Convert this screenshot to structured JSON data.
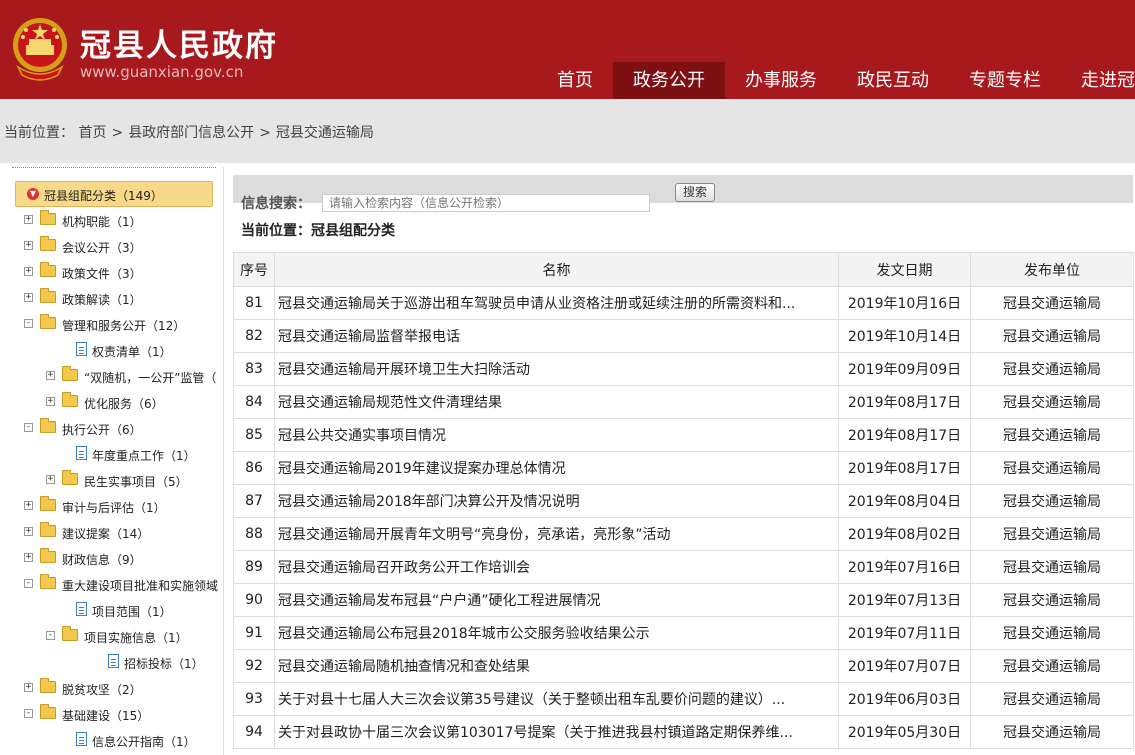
{
  "header": {
    "title": "冠县人民政府",
    "url": "www.guanxian.gov.cn",
    "nav": [
      {
        "label": "首页",
        "active": false
      },
      {
        "label": "政务公开",
        "active": true
      },
      {
        "label": "办事服务",
        "active": false
      },
      {
        "label": "政民互动",
        "active": false
      },
      {
        "label": "专题专栏",
        "active": false
      },
      {
        "label": "走进冠",
        "active": false
      }
    ]
  },
  "breadcrumb": {
    "prefix": "当前位置：",
    "items": [
      "首页",
      "县政府部门信息公开",
      "冠县交通运输局"
    ],
    "sep": ">"
  },
  "tree": {
    "root": "冠县组配分类（149）",
    "nodes": [
      {
        "label": "机构职能（1）",
        "level": 1,
        "type": "folder",
        "exp": "+"
      },
      {
        "label": "会议公开（3）",
        "level": 1,
        "type": "folder",
        "exp": "+"
      },
      {
        "label": "政策文件（3）",
        "level": 1,
        "type": "folder",
        "exp": "+"
      },
      {
        "label": "政策解读（1）",
        "level": 1,
        "type": "folder",
        "exp": "+"
      },
      {
        "label": "管理和服务公开（12）",
        "level": 1,
        "type": "folder",
        "exp": "-"
      },
      {
        "label": "权责清单（1）",
        "level": 2,
        "type": "doc",
        "exp": ""
      },
      {
        "label": "“双随机，一公开”监管（",
        "level": 2,
        "type": "folder",
        "exp": "+"
      },
      {
        "label": "优化服务（6）",
        "level": 2,
        "type": "folder",
        "exp": "+"
      },
      {
        "label": "执行公开（6）",
        "level": 1,
        "type": "folder",
        "exp": "-"
      },
      {
        "label": "年度重点工作（1）",
        "level": 2,
        "type": "doc",
        "exp": ""
      },
      {
        "label": "民生实事项目（5）",
        "level": 2,
        "type": "folder",
        "exp": "+"
      },
      {
        "label": "审计与后评估（1）",
        "level": 1,
        "type": "folder",
        "exp": "+"
      },
      {
        "label": "建议提案（14）",
        "level": 1,
        "type": "folder",
        "exp": "+"
      },
      {
        "label": "财政信息（9）",
        "level": 1,
        "type": "folder",
        "exp": "+"
      },
      {
        "label": "重大建设项目批准和实施领域",
        "level": 1,
        "type": "folder",
        "exp": "-"
      },
      {
        "label": "项目范围（1）",
        "level": 2,
        "type": "doc",
        "exp": ""
      },
      {
        "label": "项目实施信息（1）",
        "level": 2,
        "type": "folder",
        "exp": "-"
      },
      {
        "label": "招标投标（1）",
        "level": 3,
        "type": "doc",
        "exp": ""
      },
      {
        "label": "脱贫攻坚（2）",
        "level": 1,
        "type": "folder",
        "exp": "+"
      },
      {
        "label": "基础建设（15）",
        "level": 1,
        "type": "folder",
        "exp": "-"
      },
      {
        "label": "信息公开指南（1）",
        "level": 2,
        "type": "doc",
        "exp": ""
      }
    ]
  },
  "search": {
    "label": "信息搜索：",
    "placeholder": "请输入检索内容（信息公开检索）",
    "button": "搜索"
  },
  "location": "当前位置：冠县组配分类",
  "table": {
    "headers": [
      "序号",
      "名称",
      "发文日期",
      "发布单位"
    ],
    "rows": [
      [
        "81",
        "冠县交通运输局关于巡游出租车驾驶员申请从业资格注册或延续注册的所需资料和...",
        "2019年10月16日",
        "冠县交通运输局"
      ],
      [
        "82",
        "冠县交通运输局监督举报电话",
        "2019年10月14日",
        "冠县交通运输局"
      ],
      [
        "83",
        "冠县交通运输局开展环境卫生大扫除活动",
        "2019年09月09日",
        "冠县交通运输局"
      ],
      [
        "84",
        "冠县交通运输局规范性文件清理结果",
        "2019年08月17日",
        "冠县交通运输局"
      ],
      [
        "85",
        "冠县公共交通实事项目情况",
        "2019年08月17日",
        "冠县交通运输局"
      ],
      [
        "86",
        "冠县交通运输局2019年建议提案办理总体情况",
        "2019年08月17日",
        "冠县交通运输局"
      ],
      [
        "87",
        "冠县交通运输局2018年部门决算公开及情况说明",
        "2019年08月04日",
        "冠县交通运输局"
      ],
      [
        "88",
        "冠县交通运输局开展青年文明号“亮身份，亮承诺，亮形象”活动",
        "2019年08月02日",
        "冠县交通运输局"
      ],
      [
        "89",
        "冠县交通运输局召开政务公开工作培训会",
        "2019年07月16日",
        "冠县交通运输局"
      ],
      [
        "90",
        "冠县交通运输局发布冠县“户户通”硬化工程进展情况",
        "2019年07月13日",
        "冠县交通运输局"
      ],
      [
        "91",
        "冠县交通运输局公布冠县2018年城市公交服务验收结果公示",
        "2019年07月11日",
        "冠县交通运输局"
      ],
      [
        "92",
        "冠县交通运输局随机抽查情况和查处结果",
        "2019年07月07日",
        "冠县交通运输局"
      ],
      [
        "93",
        "关于对县十七届人大三次会议第35号建议（关于整顿出租车乱要价问题的建议）...",
        "2019年06月03日",
        "冠县交通运输局"
      ],
      [
        "94",
        "关于对县政协十届三次会议第103017号提案（关于推进我县村镇道路定期保养维...",
        "2019年05月30日",
        "冠县交通运输局"
      ]
    ]
  }
}
